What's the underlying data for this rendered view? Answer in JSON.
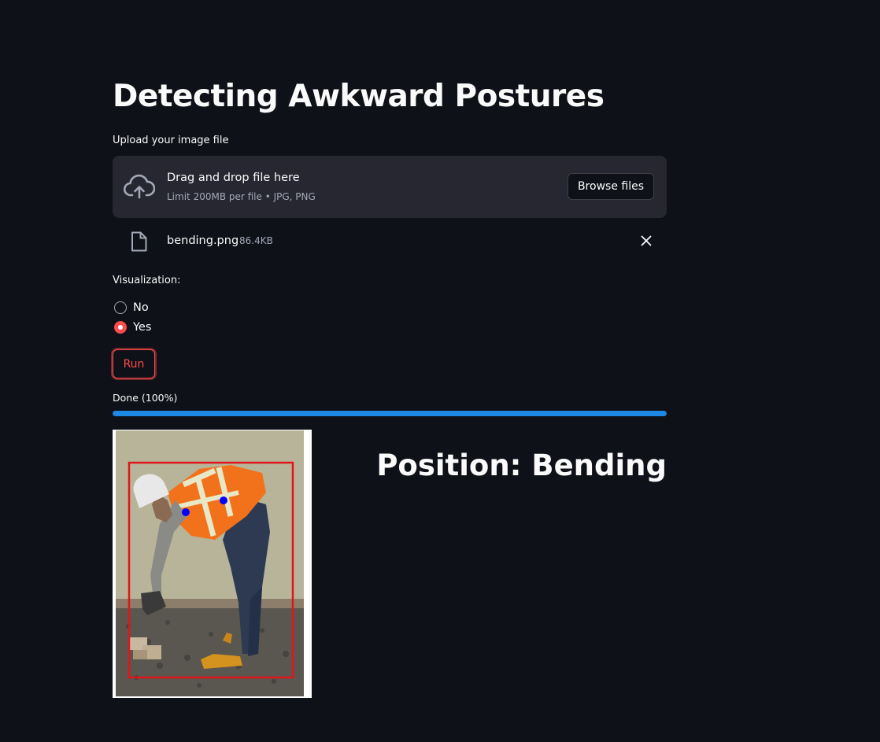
{
  "page": {
    "title": "Detecting Awkward Postures"
  },
  "uploader": {
    "label": "Upload your image file",
    "drop_text": "Drag and drop file here",
    "limit_text": "Limit 200MB per file • JPG, PNG",
    "browse_label": "Browse files",
    "icon": "cloud-upload-icon"
  },
  "uploaded_file": {
    "name": "bending.png",
    "size": "86.4KB",
    "icon": "file-icon"
  },
  "visualization": {
    "label": "Visualization:",
    "options": [
      {
        "label": "No",
        "selected": false
      },
      {
        "label": "Yes",
        "selected": true
      }
    ]
  },
  "run_button": {
    "label": "Run"
  },
  "progress": {
    "text": "Done (100%)",
    "value": 1.0
  },
  "result": {
    "heading": "Position: Bending"
  },
  "colors": {
    "background": "#0e1117",
    "surface": "#262730",
    "primary": "#ff4b4b",
    "progress": "#1e88e5",
    "bounding_box": "#e0161c",
    "keypoint": "#0000ff"
  }
}
